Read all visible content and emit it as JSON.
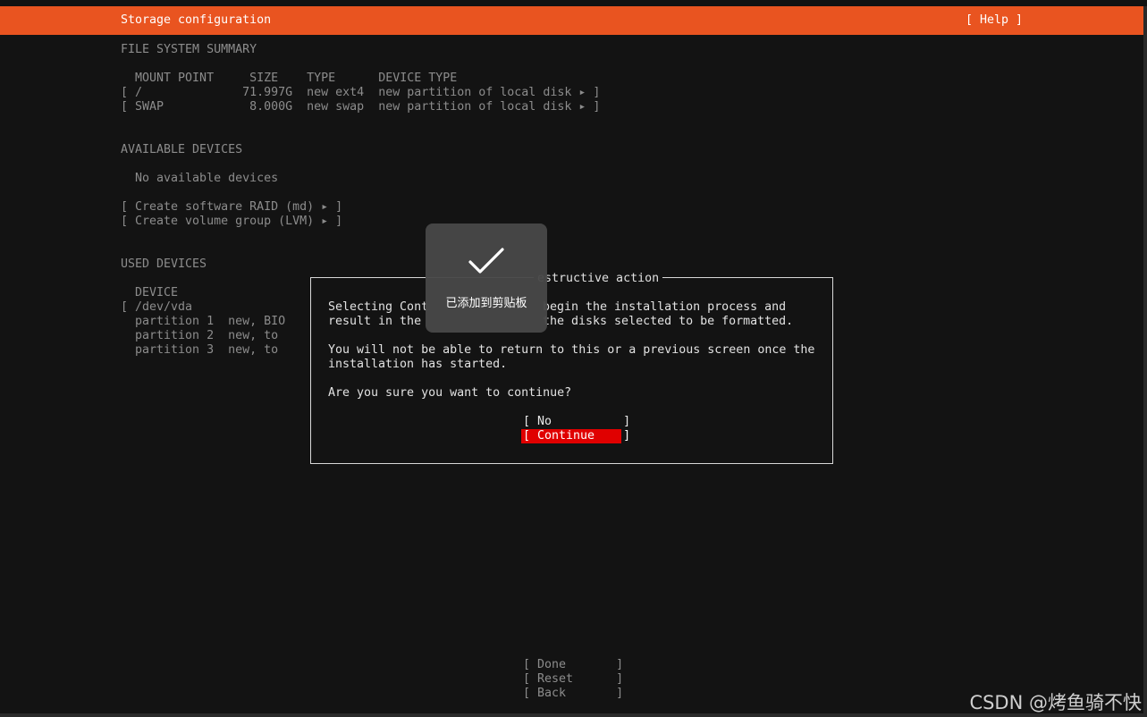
{
  "header": {
    "title": "Storage configuration",
    "help": "[ Help ]"
  },
  "summary": {
    "heading": "FILE SYSTEM SUMMARY",
    "col_headers": "  MOUNT POINT     SIZE    TYPE      DEVICE TYPE",
    "rows": [
      "[ /              71.997G  new ext4  new partition of local disk ▸ ]",
      "[ SWAP            8.000G  new swap  new partition of local disk ▸ ]"
    ]
  },
  "available": {
    "heading": "AVAILABLE DEVICES",
    "empty": "  No available devices",
    "actions": [
      "[ Create software RAID (md) ▸ ]",
      "[ Create volume group (LVM) ▸ ]"
    ]
  },
  "used": {
    "heading": "USED DEVICES",
    "col_header": "  DEVICE",
    "rows": [
      "[ /dev/vda",
      "  partition 1  new, BIO",
      "  partition 2  new, to",
      "  partition 3  new, to"
    ]
  },
  "dialog": {
    "title": "estructive action",
    "lines": [
      "Selecting Cont",
      "result in the"
    ],
    "lines_right": [
      "begin the installation process and",
      "the disks selected to be formatted."
    ],
    "para2": [
      "You will not be able to return to this or a previous screen once the",
      "installation has started."
    ],
    "question": "Are you sure you want to continue?",
    "no_label": "[ No          ]",
    "continue_label": "[ Continue    ]"
  },
  "toast": {
    "icon": "checkmark-icon",
    "message": "已添加到剪贴板"
  },
  "footer_buttons": [
    "[ Done       ]",
    "[ Reset      ]",
    "[ Back       ]"
  ],
  "watermark": "CSDN @烤鱼骑不快",
  "colors": {
    "accent": "#e95420",
    "danger": "#e00000",
    "background": "#131313"
  }
}
